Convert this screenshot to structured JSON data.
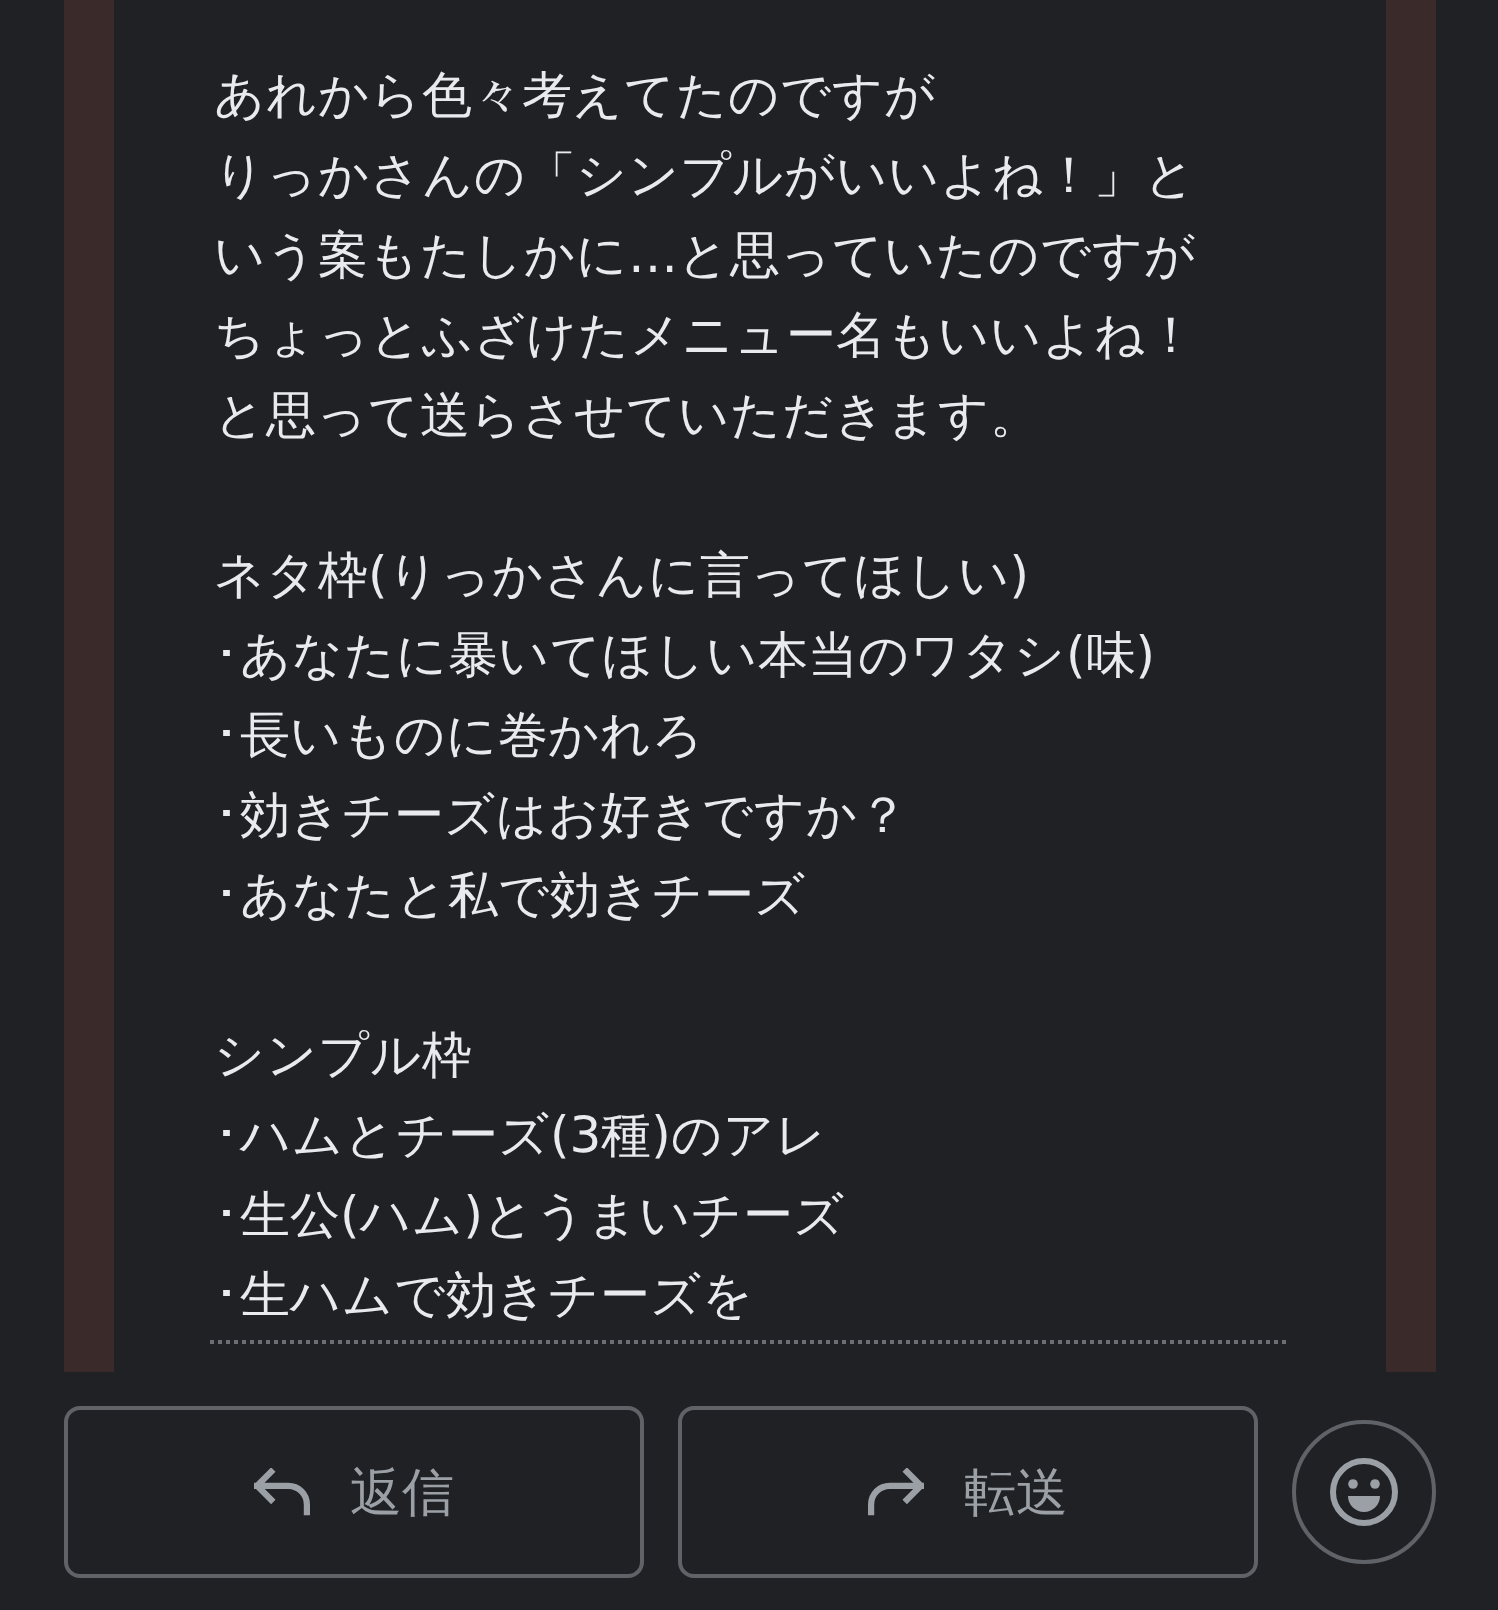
{
  "message": {
    "blocks": [
      {
        "kind": "paragraph",
        "lines": [
          "あれから色々考えてたのですが",
          "りっかさんの「シンプルがいいよね！」と",
          "いう案もたしかに…と思っていたのですが",
          "ちょっとふざけたメニュー名もいいよね！",
          "と思って送らさせていただきます。"
        ]
      },
      {
        "kind": "list",
        "heading": "ネタ枠(りっかさんに言ってほしい)",
        "items": [
          "･あなたに暴いてほしい本当のワタシ(味)",
          "･長いものに巻かれろ",
          "･効きチーズはお好きですか？",
          "･あなたと私で効きチーズ"
        ]
      },
      {
        "kind": "list",
        "heading": "シンプル枠",
        "items": [
          "･ハムとチーズ(3種)のアレ",
          "･生公(ハム)とうまいチーズ",
          "･生ハムで効きチーズを"
        ]
      }
    ]
  },
  "actions": [
    {
      "kind": "reply",
      "label": "返信"
    },
    {
      "kind": "forward",
      "label": "転送"
    }
  ]
}
